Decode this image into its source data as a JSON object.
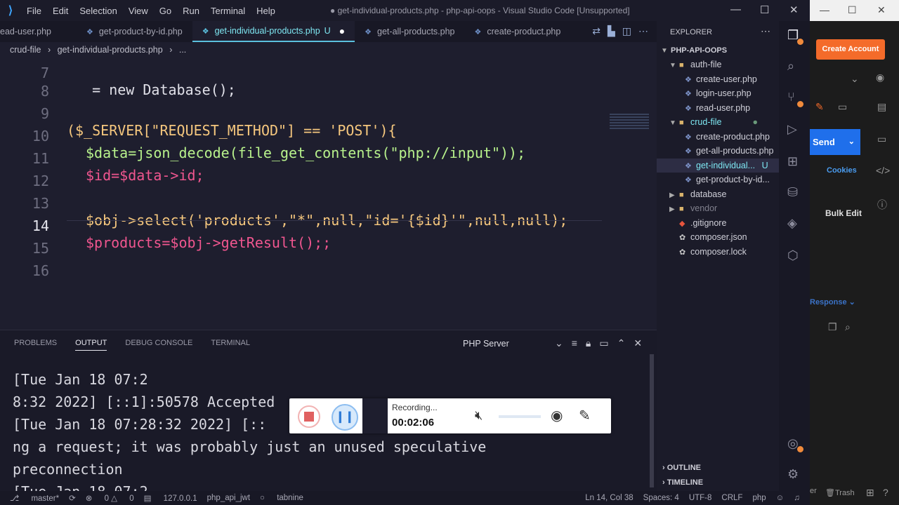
{
  "titlebar": {
    "menus": [
      "File",
      "Edit",
      "Selection",
      "View",
      "Go",
      "Run",
      "Terminal",
      "Help"
    ],
    "window_title": "● get-individual-products.php - php-api-oops - Visual Studio Code [Unsupported]"
  },
  "tabs": [
    {
      "label": "ead-user.php"
    },
    {
      "label": "get-product-by-id.php"
    },
    {
      "label": "get-individual-products.php",
      "status": "U",
      "active": true
    },
    {
      "label": "get-all-products.php"
    },
    {
      "label": "create-product.php"
    }
  ],
  "breadcrumb": {
    "folder": "crud-file",
    "file": "get-individual-products.php",
    "more": "..."
  },
  "editor": {
    "lines": [
      {
        "num": "7",
        "code": "   = new Database();"
      },
      {
        "num": "8",
        "code": ""
      },
      {
        "num": "9",
        "code": "($_SERVER[\"REQUEST_METHOD\"] == 'POST'){"
      },
      {
        "num": "10",
        "code": "$data=json_decode(file_get_contents(\"php://input\"));"
      },
      {
        "num": "11",
        "code": "$id=$data->id;"
      },
      {
        "num": "12",
        "code": ""
      },
      {
        "num": "13",
        "code": "$obj->select('products',\"*\",null,\"id='{$id}'\",null,null);"
      },
      {
        "num": "14",
        "code": "$products=$obj->getResult();;"
      },
      {
        "num": "15",
        "code": ""
      },
      {
        "num": "16",
        "code": ""
      }
    ]
  },
  "panel": {
    "tabs": [
      "PROBLEMS",
      "OUTPUT",
      "DEBUG CONSOLE",
      "TERMINAL"
    ],
    "source": "PHP Server",
    "output": "[Tue Jan 18 07:2\n8:32 2022] [::1]:50578 Accepted\n[Tue Jan 18 07:28:32 2022] [::\nng a request; it was probably just an unused speculative\npreconnection\n[Tue Jan 18 07:2"
  },
  "recorder": {
    "status": "Recording...",
    "time": "00:02:06"
  },
  "statusbar": {
    "branch": "master*",
    "errors": "0",
    "warnings": "0",
    "server": "127.0.0.1",
    "env": "php_api_jwt",
    "tabnine": "tabnine",
    "position": "Ln 14, Col 38",
    "spaces": "Spaces: 4",
    "encoding": "UTF-8",
    "eol": "CRLF",
    "language": "php"
  },
  "explorer": {
    "title": "EXPLORER",
    "root": "PHP-API-OOPS",
    "items": [
      {
        "label": "auth-file",
        "type": "folder",
        "depth": 1,
        "open": true
      },
      {
        "label": "create-user.php",
        "type": "file",
        "depth": 2
      },
      {
        "label": "login-user.php",
        "type": "file",
        "depth": 2
      },
      {
        "label": "read-user.php",
        "type": "file",
        "depth": 2
      },
      {
        "label": "crud-file",
        "type": "folder",
        "depth": 1,
        "open": true
      },
      {
        "label": "create-product.php",
        "type": "file",
        "depth": 2
      },
      {
        "label": "get-all-products.php",
        "type": "file",
        "depth": 2
      },
      {
        "label": "get-individual...",
        "type": "file",
        "depth": 2,
        "selected": true,
        "status": "U"
      },
      {
        "label": "get-product-by-id...",
        "type": "file",
        "depth": 2
      },
      {
        "label": "database",
        "type": "folder",
        "depth": 1
      },
      {
        "label": "vendor",
        "type": "folder",
        "depth": 1
      },
      {
        "label": ".gitignore",
        "type": "file",
        "depth": 1
      },
      {
        "label": "composer.json",
        "type": "file",
        "depth": 1
      },
      {
        "label": "composer.lock",
        "type": "file",
        "depth": 1
      }
    ],
    "outline": "OUTLINE",
    "timeline": "TIMELINE"
  },
  "rightapp": {
    "create_account": "Create Account",
    "send": "Send",
    "cookies": "Cookies",
    "bulk_edit": "Bulk Edit",
    "response": "Response",
    "trash": "Trash",
    "left_label": "er"
  },
  "colors": {
    "accent": "#7ee7f2",
    "variable": "#f0568f",
    "function": "#b8f28c",
    "string": "#f5c77e",
    "brand": "#f46b2a",
    "send": "#1f6feb"
  }
}
